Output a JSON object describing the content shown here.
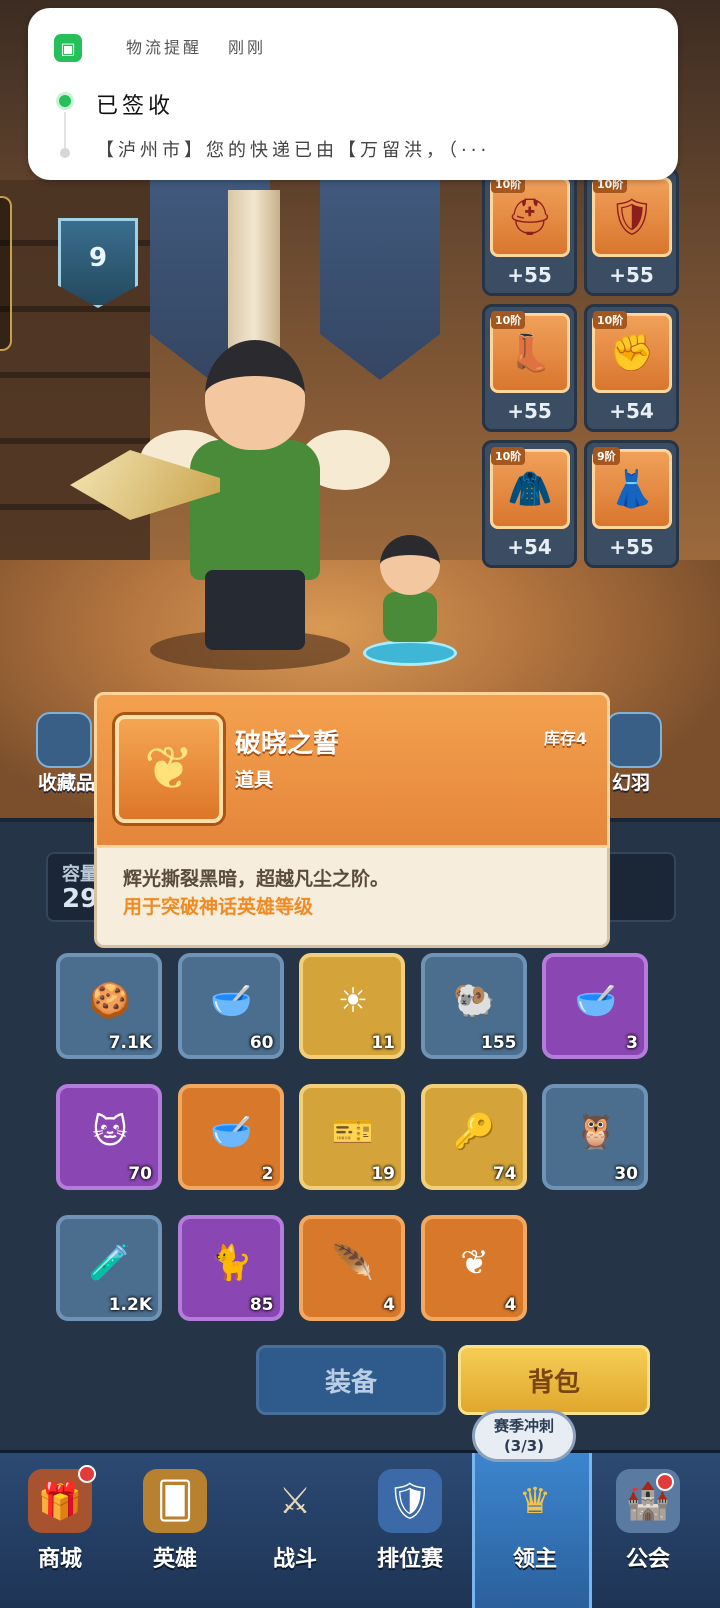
{
  "notification": {
    "app_name": "物流提醒",
    "time": "刚刚",
    "title": "已签收",
    "message": "【泸州市】您的快递已由【万留洪，（···"
  },
  "scene": {
    "rank_level": "9",
    "equipment": [
      {
        "tier": "10阶",
        "bonus": "+55",
        "icon": "helmet-icon"
      },
      {
        "tier": "10阶",
        "bonus": "+55",
        "icon": "armor-icon"
      },
      {
        "tier": "10阶",
        "bonus": "+55",
        "icon": "boots-icon"
      },
      {
        "tier": "10阶",
        "bonus": "+54",
        "icon": "gauntlet-icon"
      },
      {
        "tier": "10阶",
        "bonus": "+54",
        "icon": "cape-icon"
      },
      {
        "tier": "9阶",
        "bonus": "+55",
        "icon": "skirt-icon"
      }
    ],
    "side_left": "收藏品",
    "side_right": "幻羽"
  },
  "tooltip": {
    "name": "破晓之誓",
    "type": "道具",
    "stock": "库存4",
    "description": "辉光撕裂黑暗，超越凡尘之阶。",
    "usage": "用于突破神话英雄等级"
  },
  "capacity": {
    "label": "容量",
    "value": "29"
  },
  "inventory": [
    {
      "count": "7.1K",
      "rarity": "blue",
      "icon": "cookie-icon",
      "glyph": "🍪"
    },
    {
      "count": "60",
      "rarity": "blue",
      "icon": "blue-potion-bowl-icon",
      "glyph": "🥣"
    },
    {
      "count": "11",
      "rarity": "gold",
      "icon": "sun-emblem-icon",
      "glyph": "☀"
    },
    {
      "count": "155",
      "rarity": "blue",
      "icon": "ram-puzzle-icon",
      "glyph": "🐏"
    },
    {
      "count": "3",
      "rarity": "purple",
      "icon": "purple-potion-bowl-icon",
      "glyph": "🥣"
    },
    {
      "count": "70",
      "rarity": "purple",
      "icon": "cat-puzzle-icon",
      "glyph": "🐱"
    },
    {
      "count": "2",
      "rarity": "orange",
      "icon": "gold-potion-bowl-icon",
      "glyph": "🥣"
    },
    {
      "count": "19",
      "rarity": "gold",
      "icon": "ticket-icon",
      "glyph": "🎫"
    },
    {
      "count": "74",
      "rarity": "gold",
      "icon": "golden-key-icon",
      "glyph": "🔑"
    },
    {
      "count": "30",
      "rarity": "blue",
      "icon": "owl-puzzle-icon",
      "glyph": "🦉"
    },
    {
      "count": "1.2K",
      "rarity": "blue",
      "icon": "exp-potion-icon",
      "glyph": "🧪"
    },
    {
      "count": "85",
      "rarity": "purple",
      "icon": "shadow-cat-puzzle-icon",
      "glyph": "🐈"
    },
    {
      "count": "4",
      "rarity": "orange",
      "icon": "purple-feather-icon",
      "glyph": "🪶"
    },
    {
      "count": "4",
      "rarity": "orange",
      "icon": "dawn-oath-icon",
      "glyph": "❦"
    }
  ],
  "tabs": {
    "equip": "装备",
    "bag": "背包"
  },
  "season": {
    "line1": "赛季冲刺",
    "line2": "(3/3)"
  },
  "nav": [
    {
      "label": "商城",
      "icon": "shop-chest-icon",
      "glyph": "🎁"
    },
    {
      "label": "英雄",
      "icon": "hero-card-icon",
      "glyph": "🂠"
    },
    {
      "label": "战斗",
      "icon": "crossed-swords-icon",
      "glyph": "⚔"
    },
    {
      "label": "排位赛",
      "icon": "ranked-shield-icon",
      "glyph": "🛡"
    },
    {
      "label": "领主",
      "icon": "lord-crown-icon",
      "glyph": "♛"
    },
    {
      "label": "公会",
      "icon": "guild-castle-icon",
      "glyph": "🏰"
    }
  ]
}
